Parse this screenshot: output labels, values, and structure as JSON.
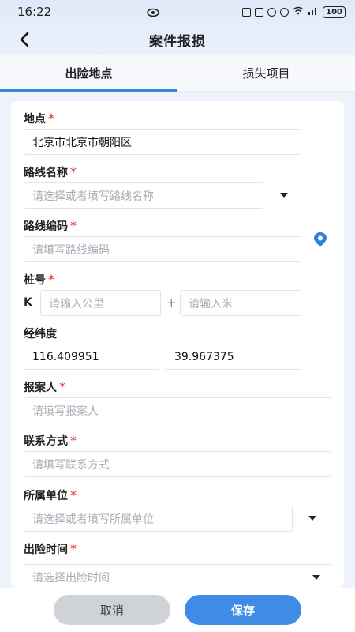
{
  "status": {
    "time": "16:22",
    "battery": "100"
  },
  "header": {
    "title": "案件报损"
  },
  "tabs": [
    {
      "label": "出险地点"
    },
    {
      "label": "损失项目"
    }
  ],
  "form": {
    "location": {
      "label": "地点",
      "required": "*",
      "value": "北京市北京市朝阳区"
    },
    "route_name": {
      "label": "路线名称",
      "required": "*",
      "placeholder": "请选择或者填写路线名称"
    },
    "route_code": {
      "label": "路线编码",
      "required": "*",
      "placeholder": "请填写路线编码"
    },
    "stake": {
      "label": "桩号",
      "required": "*",
      "prefix": "K",
      "km_placeholder": "请输入公里",
      "plus": "+",
      "m_placeholder": "请输入米"
    },
    "coords": {
      "label": "经纬度",
      "longitude": "116.409951",
      "latitude": "39.967375"
    },
    "reporter": {
      "label": "报案人",
      "required": "*",
      "placeholder": "请填写报案人"
    },
    "contact": {
      "label": "联系方式",
      "required": "*",
      "placeholder": "请填写联系方式"
    },
    "unit": {
      "label": "所属单位",
      "required": "*",
      "placeholder": "请选择或者填写所属单位"
    },
    "time": {
      "label": "出险时间",
      "required": "*",
      "placeholder": "请选择出险时间"
    }
  },
  "actions": {
    "cancel": "取消",
    "save": "保存"
  },
  "colors": {
    "accent": "#3f8be6",
    "required": "#e02424",
    "cancel_bg": "#cfd3d8"
  }
}
